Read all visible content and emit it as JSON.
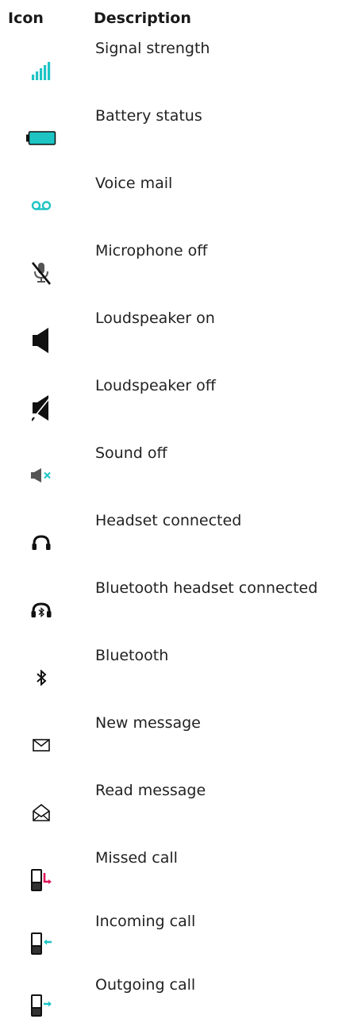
{
  "table": {
    "headers": {
      "icon": "Icon",
      "description": "Description"
    },
    "rows": [
      {
        "icon": "signal-strength-icon",
        "description": "Signal strength"
      },
      {
        "icon": "battery-icon",
        "description": "Battery status"
      },
      {
        "icon": "voicemail-icon",
        "description": "Voice mail"
      },
      {
        "icon": "microphone-off-icon",
        "description": "Microphone off"
      },
      {
        "icon": "loudspeaker-on-icon",
        "description": "Loudspeaker on"
      },
      {
        "icon": "loudspeaker-off-icon",
        "description": "Loudspeaker off"
      },
      {
        "icon": "sound-off-icon",
        "description": "Sound off"
      },
      {
        "icon": "headset-icon",
        "description": "Headset connected"
      },
      {
        "icon": "bluetooth-headset-icon",
        "description": "Bluetooth headset connected"
      },
      {
        "icon": "bluetooth-icon",
        "description": "Bluetooth"
      },
      {
        "icon": "new-message-icon",
        "description": "New message"
      },
      {
        "icon": "read-message-icon",
        "description": "Read message"
      },
      {
        "icon": "missed-call-icon",
        "description": "Missed call"
      },
      {
        "icon": "incoming-call-icon",
        "description": "Incoming call"
      },
      {
        "icon": "outgoing-call-icon",
        "description": "Outgoing call"
      }
    ]
  },
  "colors": {
    "teal": "#1ec4c4",
    "missed": "#e0185a",
    "dark": "#111111",
    "gray": "#555555"
  }
}
